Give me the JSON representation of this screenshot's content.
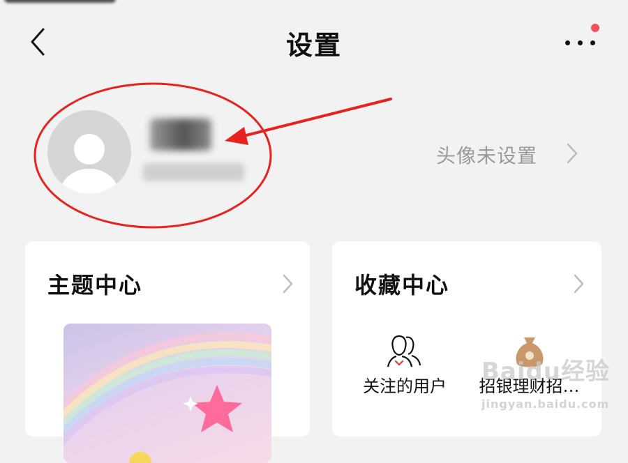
{
  "header": {
    "title": "设置",
    "back_icon": "chevron-left-icon",
    "more_icon": "more-horizontal-icon",
    "notification_color": "#f0505a"
  },
  "profile": {
    "avatar_status": "头像未设置",
    "chevron_icon": "chevron-right-icon",
    "annotation_color": "#e8231f"
  },
  "cards": {
    "theme": {
      "title": "主题中心"
    },
    "favorites": {
      "title": "收藏中心",
      "items": [
        {
          "label": "关注的用户",
          "icon": "users-icon"
        },
        {
          "label": "招银理财招…",
          "icon": "money-bag-icon"
        }
      ]
    }
  },
  "watermark": {
    "brand": "Baidu",
    "suffix": "经验",
    "sub": "jingyan.baidu.com"
  }
}
